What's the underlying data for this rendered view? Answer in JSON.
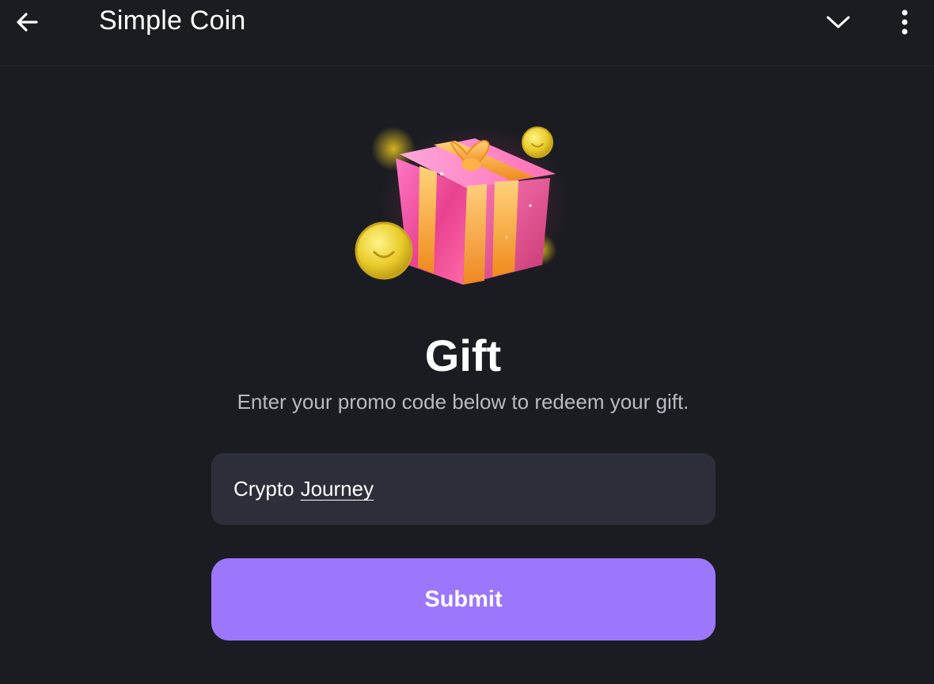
{
  "app_bar": {
    "title": "Simple Coin",
    "back_icon": "arrow-left-icon",
    "dropdown_icon": "chevron-down-icon",
    "menu_icon": "more-vertical-icon"
  },
  "gift": {
    "illustration": "gift-box-with-coins",
    "title": "Gift",
    "subtitle": "Enter your promo code below to redeem your gift."
  },
  "promo_input": {
    "value_word_1": "Crypto",
    "value_word_2": "Journey"
  },
  "submit": {
    "label": "Submit"
  },
  "colors": {
    "background": "#1b1c22",
    "input_background": "#2c2e39",
    "accent": "#9c77fb",
    "subtitle_text": "#b9bac2"
  }
}
